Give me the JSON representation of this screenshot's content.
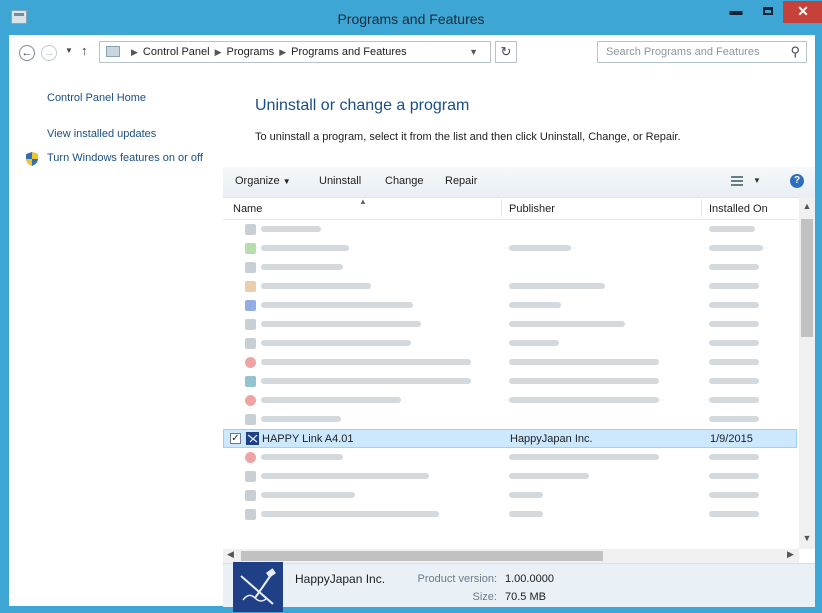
{
  "window": {
    "title": "Programs and Features"
  },
  "address": {
    "crumbs": [
      "Control Panel",
      "Programs",
      "Programs and Features"
    ],
    "search_placeholder": "Search Programs and Features"
  },
  "left_pane": {
    "links": [
      "Control Panel Home",
      "View installed updates",
      "Turn Windows features on or off"
    ]
  },
  "main": {
    "heading": "Uninstall or change a program",
    "subtext": "To uninstall a program, select it from the list and then click Uninstall, Change, or Repair."
  },
  "toolbar": {
    "organize": "Organize",
    "uninstall": "Uninstall",
    "change": "Change",
    "repair": "Repair"
  },
  "columns": {
    "name": "Name",
    "publisher": "Publisher",
    "installed_on": "Installed On"
  },
  "selected_program": {
    "name": "HAPPY Link A4.01",
    "publisher": "HappyJapan Inc.",
    "installed_on": "1/9/2015"
  },
  "details": {
    "publisher": "HappyJapan Inc.",
    "version_label": "Product version:",
    "version": "1.00.0000",
    "size_label": "Size:",
    "size": "70.5 MB"
  },
  "colors": {
    "title_bar": "#3ea6d4",
    "selection": "#cce8ff",
    "link": "#1a4f86",
    "close": "#c7413b"
  }
}
